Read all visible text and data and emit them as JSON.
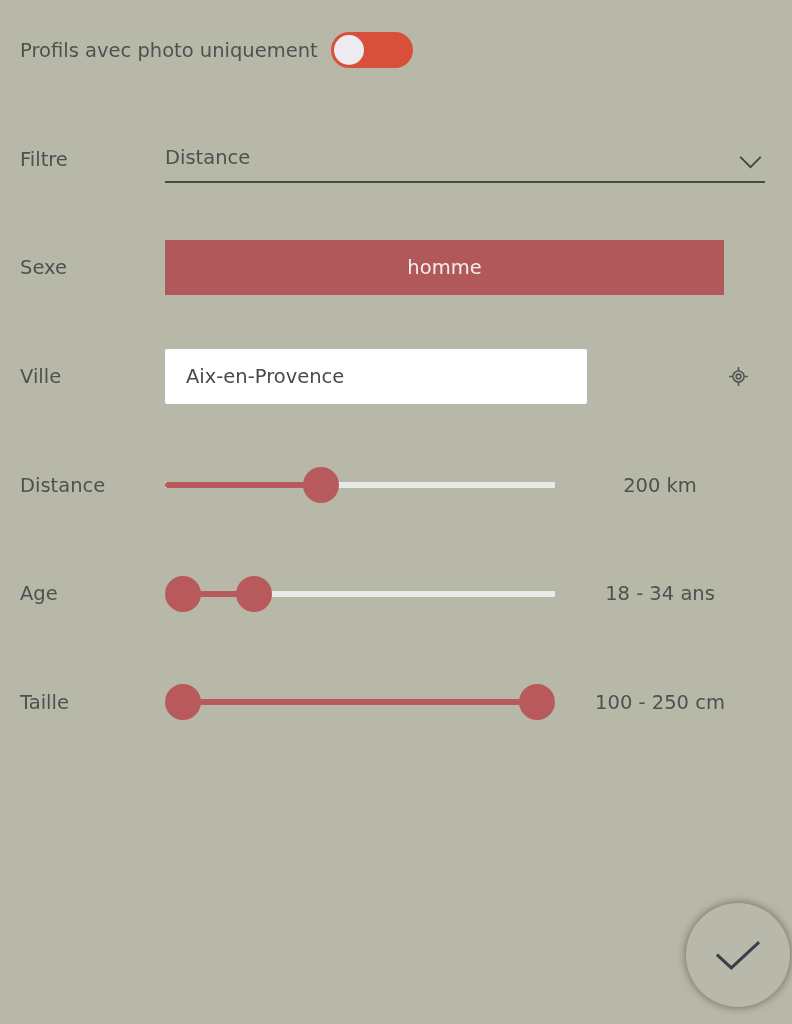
{
  "photo_only": {
    "label": "Profils avec photo uniquement",
    "on": false
  },
  "fields": [
    {
      "kind": "select",
      "label": "Filtre",
      "value": "Distance"
    },
    {
      "kind": "button",
      "label": "Sexe",
      "value": "homme"
    },
    {
      "kind": "text_input",
      "label": "Ville",
      "value": "Aix-en-Provence"
    },
    {
      "kind": "slider",
      "label": "Distance",
      "level": 0.39,
      "reading": "200 km"
    },
    {
      "kind": "range",
      "label": "Age",
      "thumbs": [
        {
          "level": 0
        },
        {
          "level": 0.2
        }
      ],
      "reading": "18 - 34 ans"
    },
    {
      "kind": "range",
      "label": "Taille",
      "thumbs": [
        {
          "level": 0
        },
        {
          "level": 1
        }
      ],
      "reading": "100 - 250 cm"
    }
  ]
}
